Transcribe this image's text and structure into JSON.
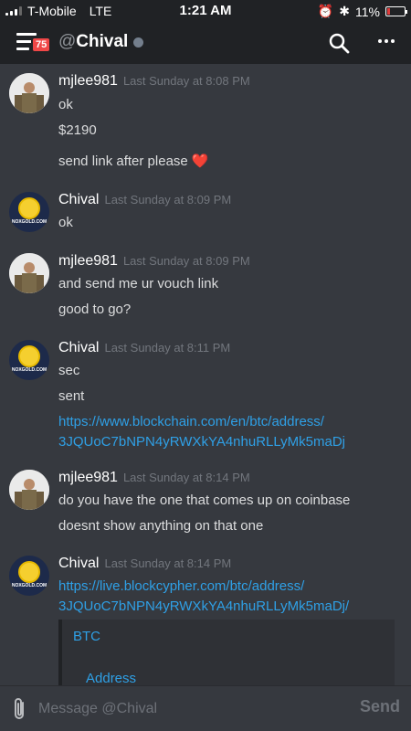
{
  "status_bar": {
    "carrier": "T-Mobile",
    "network": "LTE",
    "time": "1:21 AM",
    "battery": "11%",
    "battery_level": 0.11
  },
  "header": {
    "badge_count": "75",
    "at_symbol": "@",
    "channel_name": "Chival"
  },
  "messages": [
    {
      "author": "mjlee981",
      "timestamp": "Last Sunday at 8:08 PM",
      "lines": [
        "ok",
        "$2190",
        "send link after please ❤️"
      ]
    },
    {
      "author": "Chival",
      "timestamp": "Last Sunday at 8:09 PM",
      "avatar_text": "NOXGOLD.COM",
      "lines": [
        "ok"
      ]
    },
    {
      "author": "mjlee981",
      "timestamp": "Last Sunday at 8:09 PM",
      "lines": [
        "and send me ur vouch link",
        "good to go?"
      ]
    },
    {
      "author": "Chival",
      "timestamp": "Last Sunday at 8:11 PM",
      "avatar_text": "NOXGOLD.COM",
      "lines": [
        "sec",
        "sent",
        "https://www.blockchain.com/en/btc/address/",
        "3JQUoC7bNPN4yRWXkYA4nhuRLLyMk5maDj"
      ]
    },
    {
      "author": "mjlee981",
      "timestamp": "Last Sunday at 8:14 PM",
      "lines": [
        "do you have the one that comes up on coinbase",
        "doesnt show anything on that one"
      ]
    },
    {
      "author": "Chival",
      "timestamp": "Last Sunday at 8:14 PM",
      "avatar_text": "NOXGOLD.COM",
      "lines": [
        "https://live.blockcypher.com/btc/address/",
        "3JQUoC7bNPN4yRWXkYA4nhuRLLyMk5maDj/"
      ]
    }
  ],
  "embed": {
    "title": "BTC",
    "field": "Address"
  },
  "input": {
    "placeholder": "Message @Chival",
    "send_label": "Send"
  },
  "colors": {
    "link": "#2fa0e6",
    "background": "#36393f",
    "header": "#202225",
    "badge": "#f04747"
  }
}
